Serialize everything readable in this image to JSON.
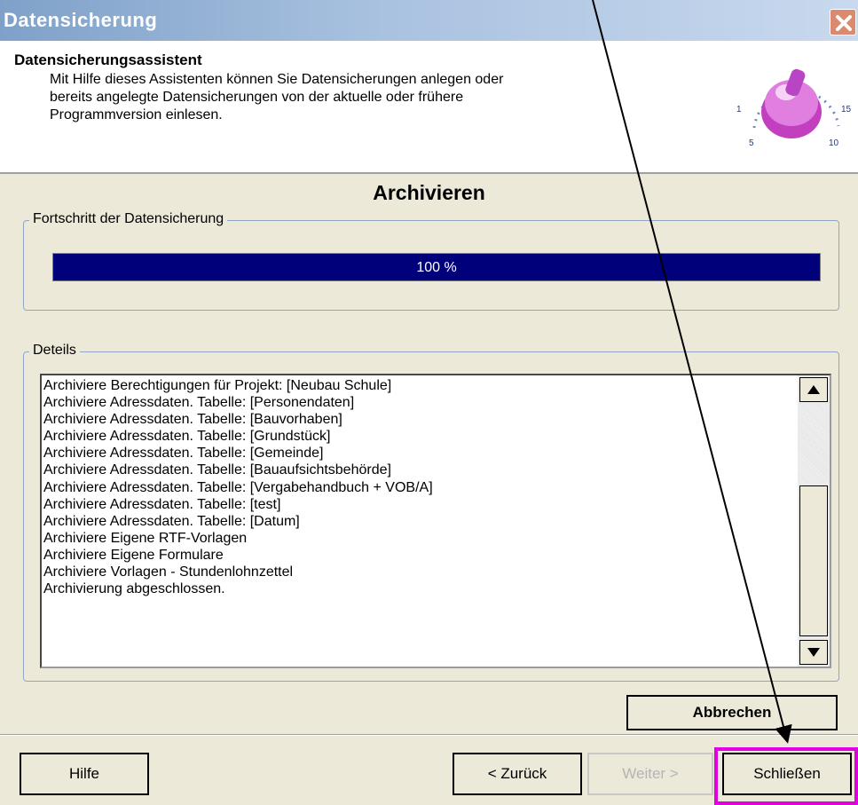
{
  "window": {
    "title": "Datensicherung"
  },
  "header": {
    "title": "Datensicherungsassistent",
    "desc_lines": [
      "Mit Hilfe dieses Assistenten können Sie Datensicherungen anlegen oder",
      "bereits angelegte Datensicherungen von der aktuelle oder frühere",
      "Programmversion einlesen."
    ],
    "icon": "dial-knob-icon",
    "dial_labels": [
      "1",
      "5",
      "10",
      "15"
    ]
  },
  "section": {
    "title": "Archivieren"
  },
  "progress": {
    "legend": "Fortschritt der Datensicherung",
    "value": 100,
    "text": "100 %",
    "color": "#00007b"
  },
  "details": {
    "legend": "Deteils",
    "items": [
      "Archiviere Berechtigungen für Projekt: [Neubau Schule]",
      "Archiviere Adressdaten. Tabelle: [Personendaten]",
      "Archiviere Adressdaten. Tabelle: [Bauvorhaben]",
      "Archiviere Adressdaten. Tabelle: [Grundstück]",
      "Archiviere Adressdaten. Tabelle: [Gemeinde]",
      "Archiviere Adressdaten. Tabelle: [Bauaufsichtsbehörde]",
      "Archiviere Adressdaten. Tabelle: [Vergabehandbuch + VOB/A]",
      "Archiviere Adressdaten. Tabelle: [test]",
      "Archiviere Adressdaten. Tabelle: [Datum]",
      "Archiviere Eigene RTF-Vorlagen",
      "Archiviere Eigene Formulare",
      "Archiviere Vorlagen - Stundenlohnzettel",
      "Archivierung abgeschlossen."
    ]
  },
  "buttons": {
    "abbrechen": "Abbrechen",
    "hilfe": "Hilfe",
    "zurueck": "< Zurück",
    "weiter": "Weiter >",
    "schliessen": "Schließen"
  },
  "colors": {
    "highlight": "#e000e0",
    "title_bar": "#a9c2e0"
  }
}
